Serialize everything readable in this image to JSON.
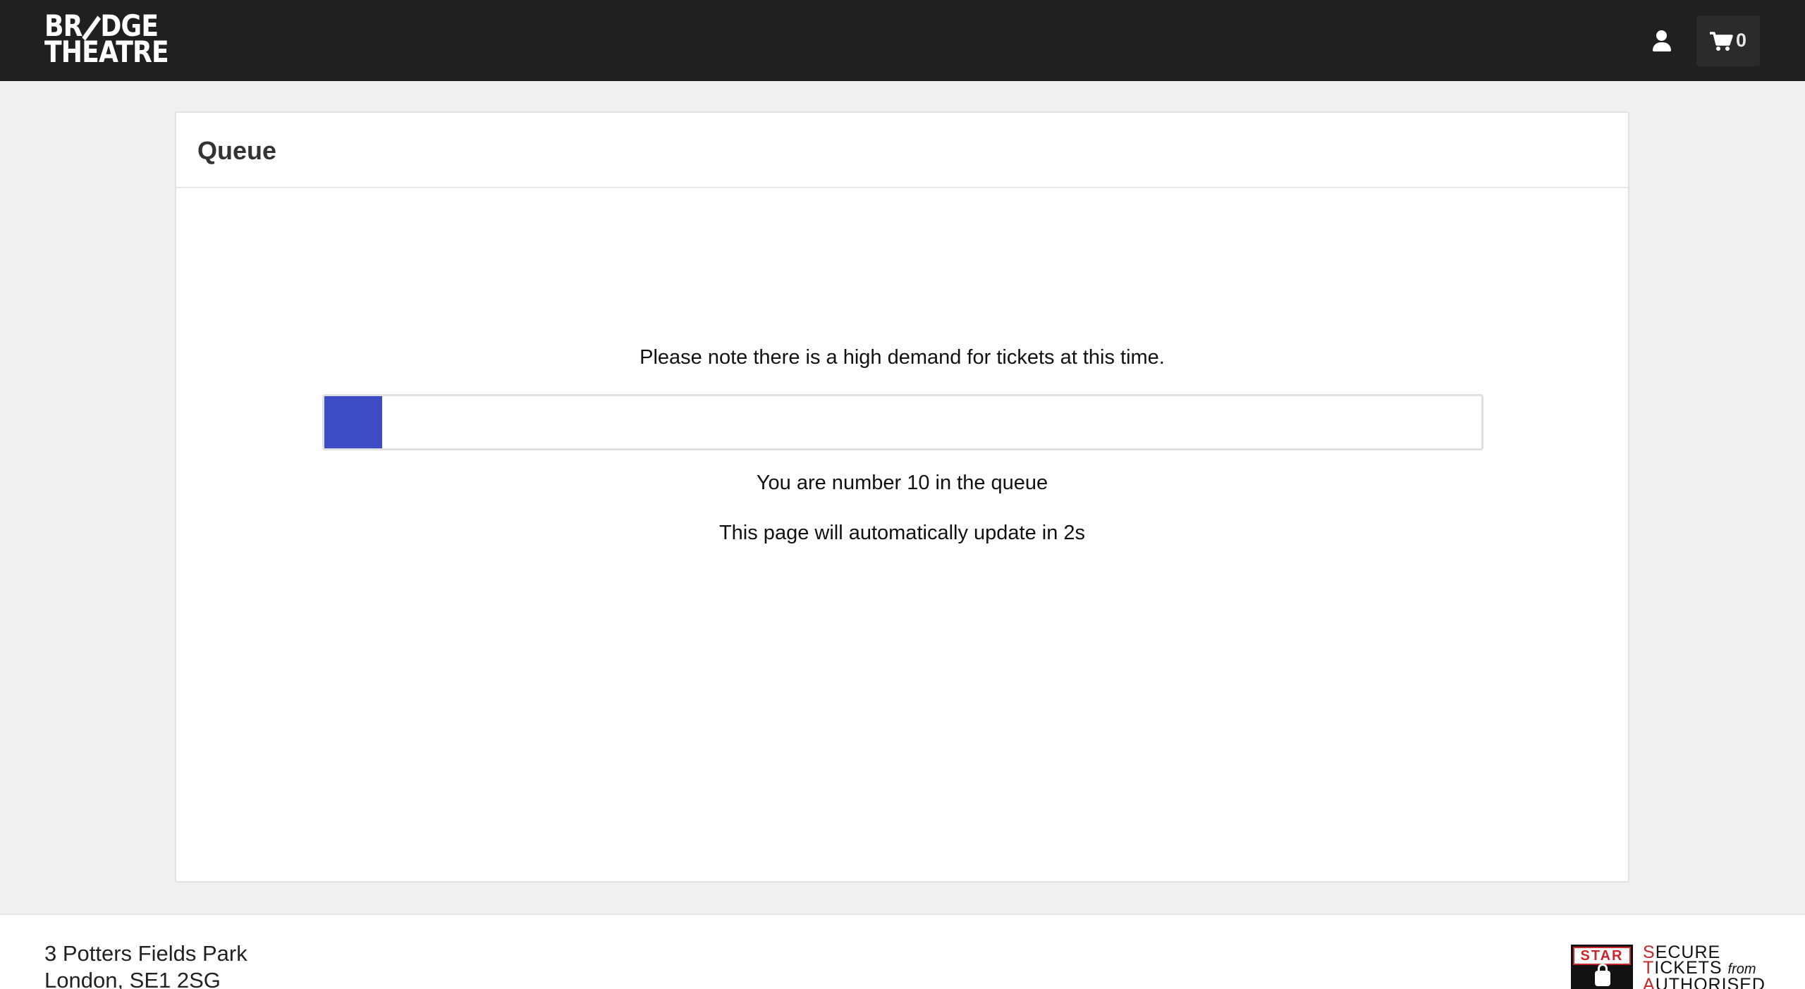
{
  "header": {
    "logo": {
      "line1_a": "BR",
      "line1_b": "DGE",
      "line2": "THEATRE"
    },
    "account_icon": "user-icon",
    "cart": {
      "icon": "shopping-cart-icon",
      "count": "0"
    },
    "background_color": "#202020"
  },
  "queue": {
    "title": "Queue",
    "demand_note": "Please note there is a high demand for tickets at this time.",
    "progress_percent": 5,
    "progress_color": "#3d4bc4",
    "position_text": "You are number 10 in the queue",
    "update_text": "This page will automatically update in 2s"
  },
  "footer": {
    "address_line1": "3 Potters Fields Park",
    "address_line2": "London, SE1 2SG",
    "star_badge": {
      "label": "STAR",
      "lines": [
        {
          "initial": "S",
          "rest": "ECURE"
        },
        {
          "initial": "T",
          "rest": "ICKETS",
          "suffix": "from"
        },
        {
          "initial": "A",
          "rest": "UTHORISED"
        }
      ],
      "accent_color": "#c8262b"
    }
  }
}
